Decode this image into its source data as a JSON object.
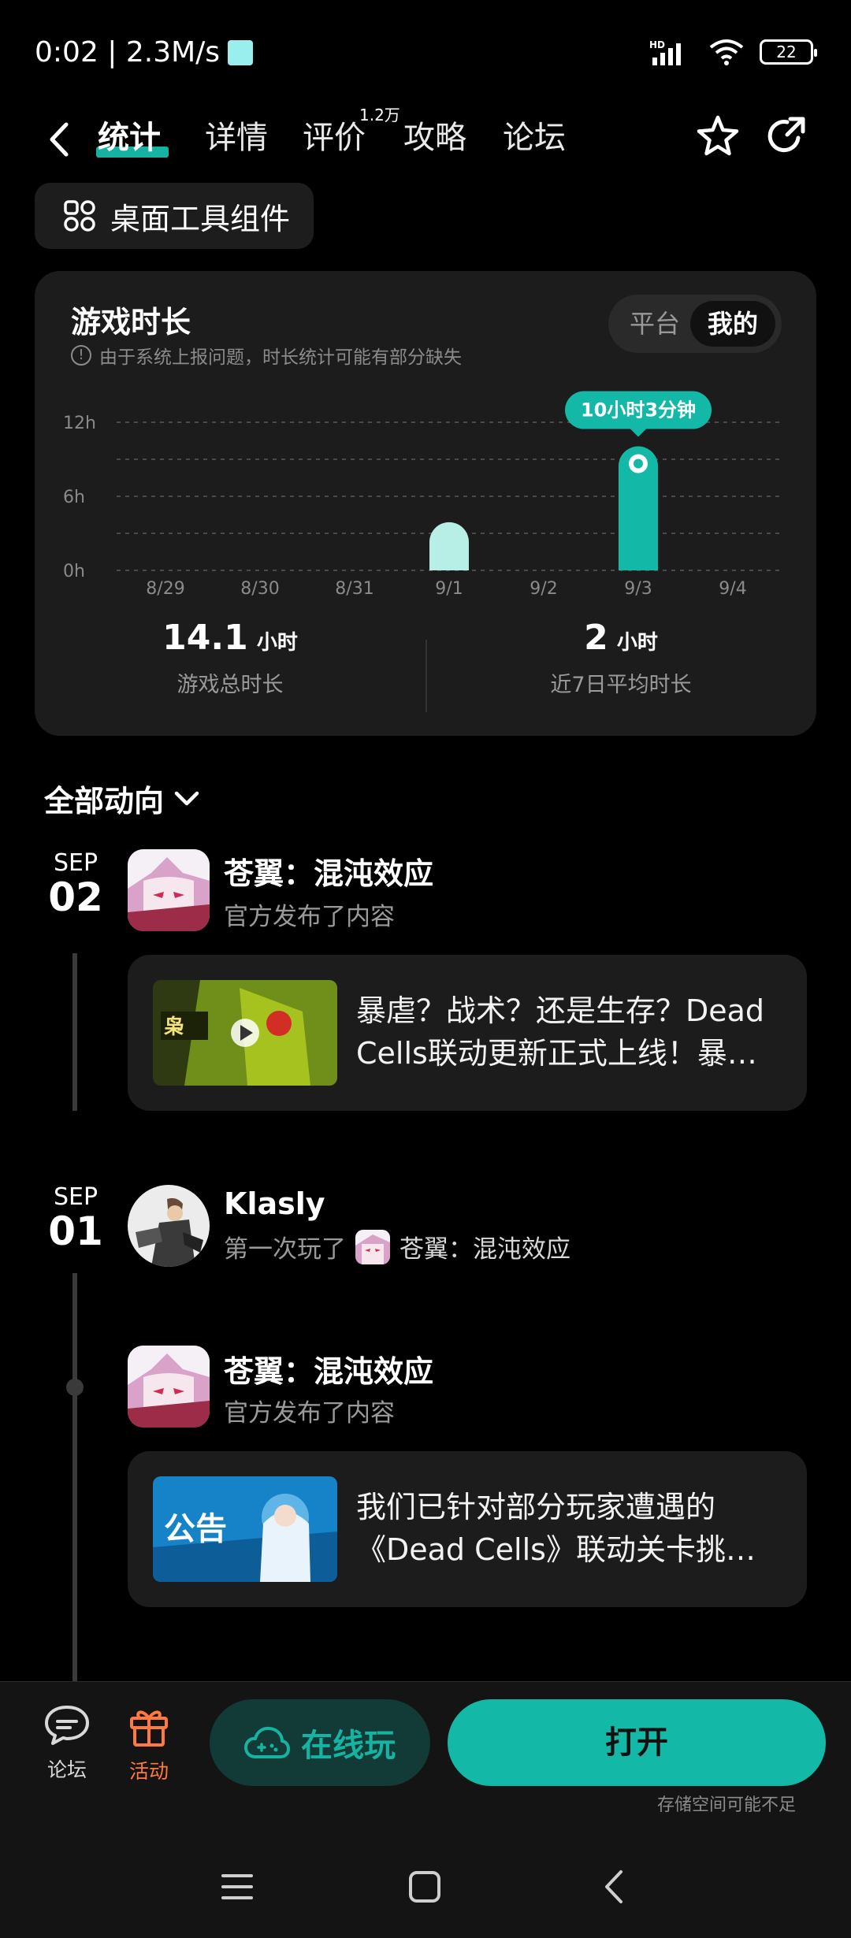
{
  "status_bar": {
    "time_speed": "0:02 | 2.3M/s",
    "network": "HD",
    "battery": "22"
  },
  "nav": {
    "tabs": [
      {
        "label": "统计",
        "active": true
      },
      {
        "label": "详情",
        "active": false
      },
      {
        "label": "评价",
        "active": false,
        "badge": "1.2万"
      },
      {
        "label": "攻略",
        "active": false
      },
      {
        "label": "论坛",
        "active": false
      }
    ]
  },
  "widget_button": "桌面工具组件",
  "stats": {
    "title": "游戏时长",
    "note": "由于系统上报问题，时长统计可能有部分缺失",
    "toggle": {
      "option_1": "平台",
      "option_2": "我的",
      "selected": "我的"
    },
    "total_value": "14.1",
    "total_unit": "小时",
    "total_label": "游戏总时长",
    "avg_value": "2",
    "avg_unit": "小时",
    "avg_label": "近7日平均时长"
  },
  "chart_data": {
    "type": "bar",
    "categories": [
      "8/29",
      "8/30",
      "8/31",
      "9/1",
      "9/2",
      "9/3",
      "9/4"
    ],
    "values": [
      0,
      0,
      0,
      3.9,
      0,
      10.05,
      0
    ],
    "ylim": [
      0,
      12
    ],
    "yticks": [
      "0h",
      "6h",
      "12h"
    ],
    "grid": true,
    "highlight_index": 5,
    "highlight_label": "10小时3分钟",
    "colors": {
      "highlight": "#14b8a6",
      "normal": "#b7efe6"
    }
  },
  "feed": {
    "filter_label": "全部动向",
    "groups": [
      {
        "month": "SEP",
        "day": "02",
        "entries": [
          {
            "title": "苍翼：混沌效应",
            "subtitle": "官方发布了内容",
            "card_line1": "暴虐？战术？还是生存？Dead",
            "card_line2": "Cells联动更新正式上线！暴虐？战术？还是生存？"
          }
        ]
      },
      {
        "month": "SEP",
        "day": "01",
        "entries": [
          {
            "title": "Klasly",
            "subtitle": "第一次玩了",
            "game": "苍翼：混沌效应"
          },
          {
            "title": "苍翼：混沌效应",
            "subtitle": "官方发布了内容",
            "thumb_text": "公告",
            "card_line1": "我们已针对部分玩家遭遇的",
            "card_line2": "《Dead Cells》联动关卡挑战异常问题进行修复"
          }
        ]
      }
    ]
  },
  "action_bar": {
    "forum_label": "论坛",
    "activity_label": "活动",
    "play_online": "在线玩",
    "open": "打开",
    "storage_note": "存储空间可能不足"
  }
}
